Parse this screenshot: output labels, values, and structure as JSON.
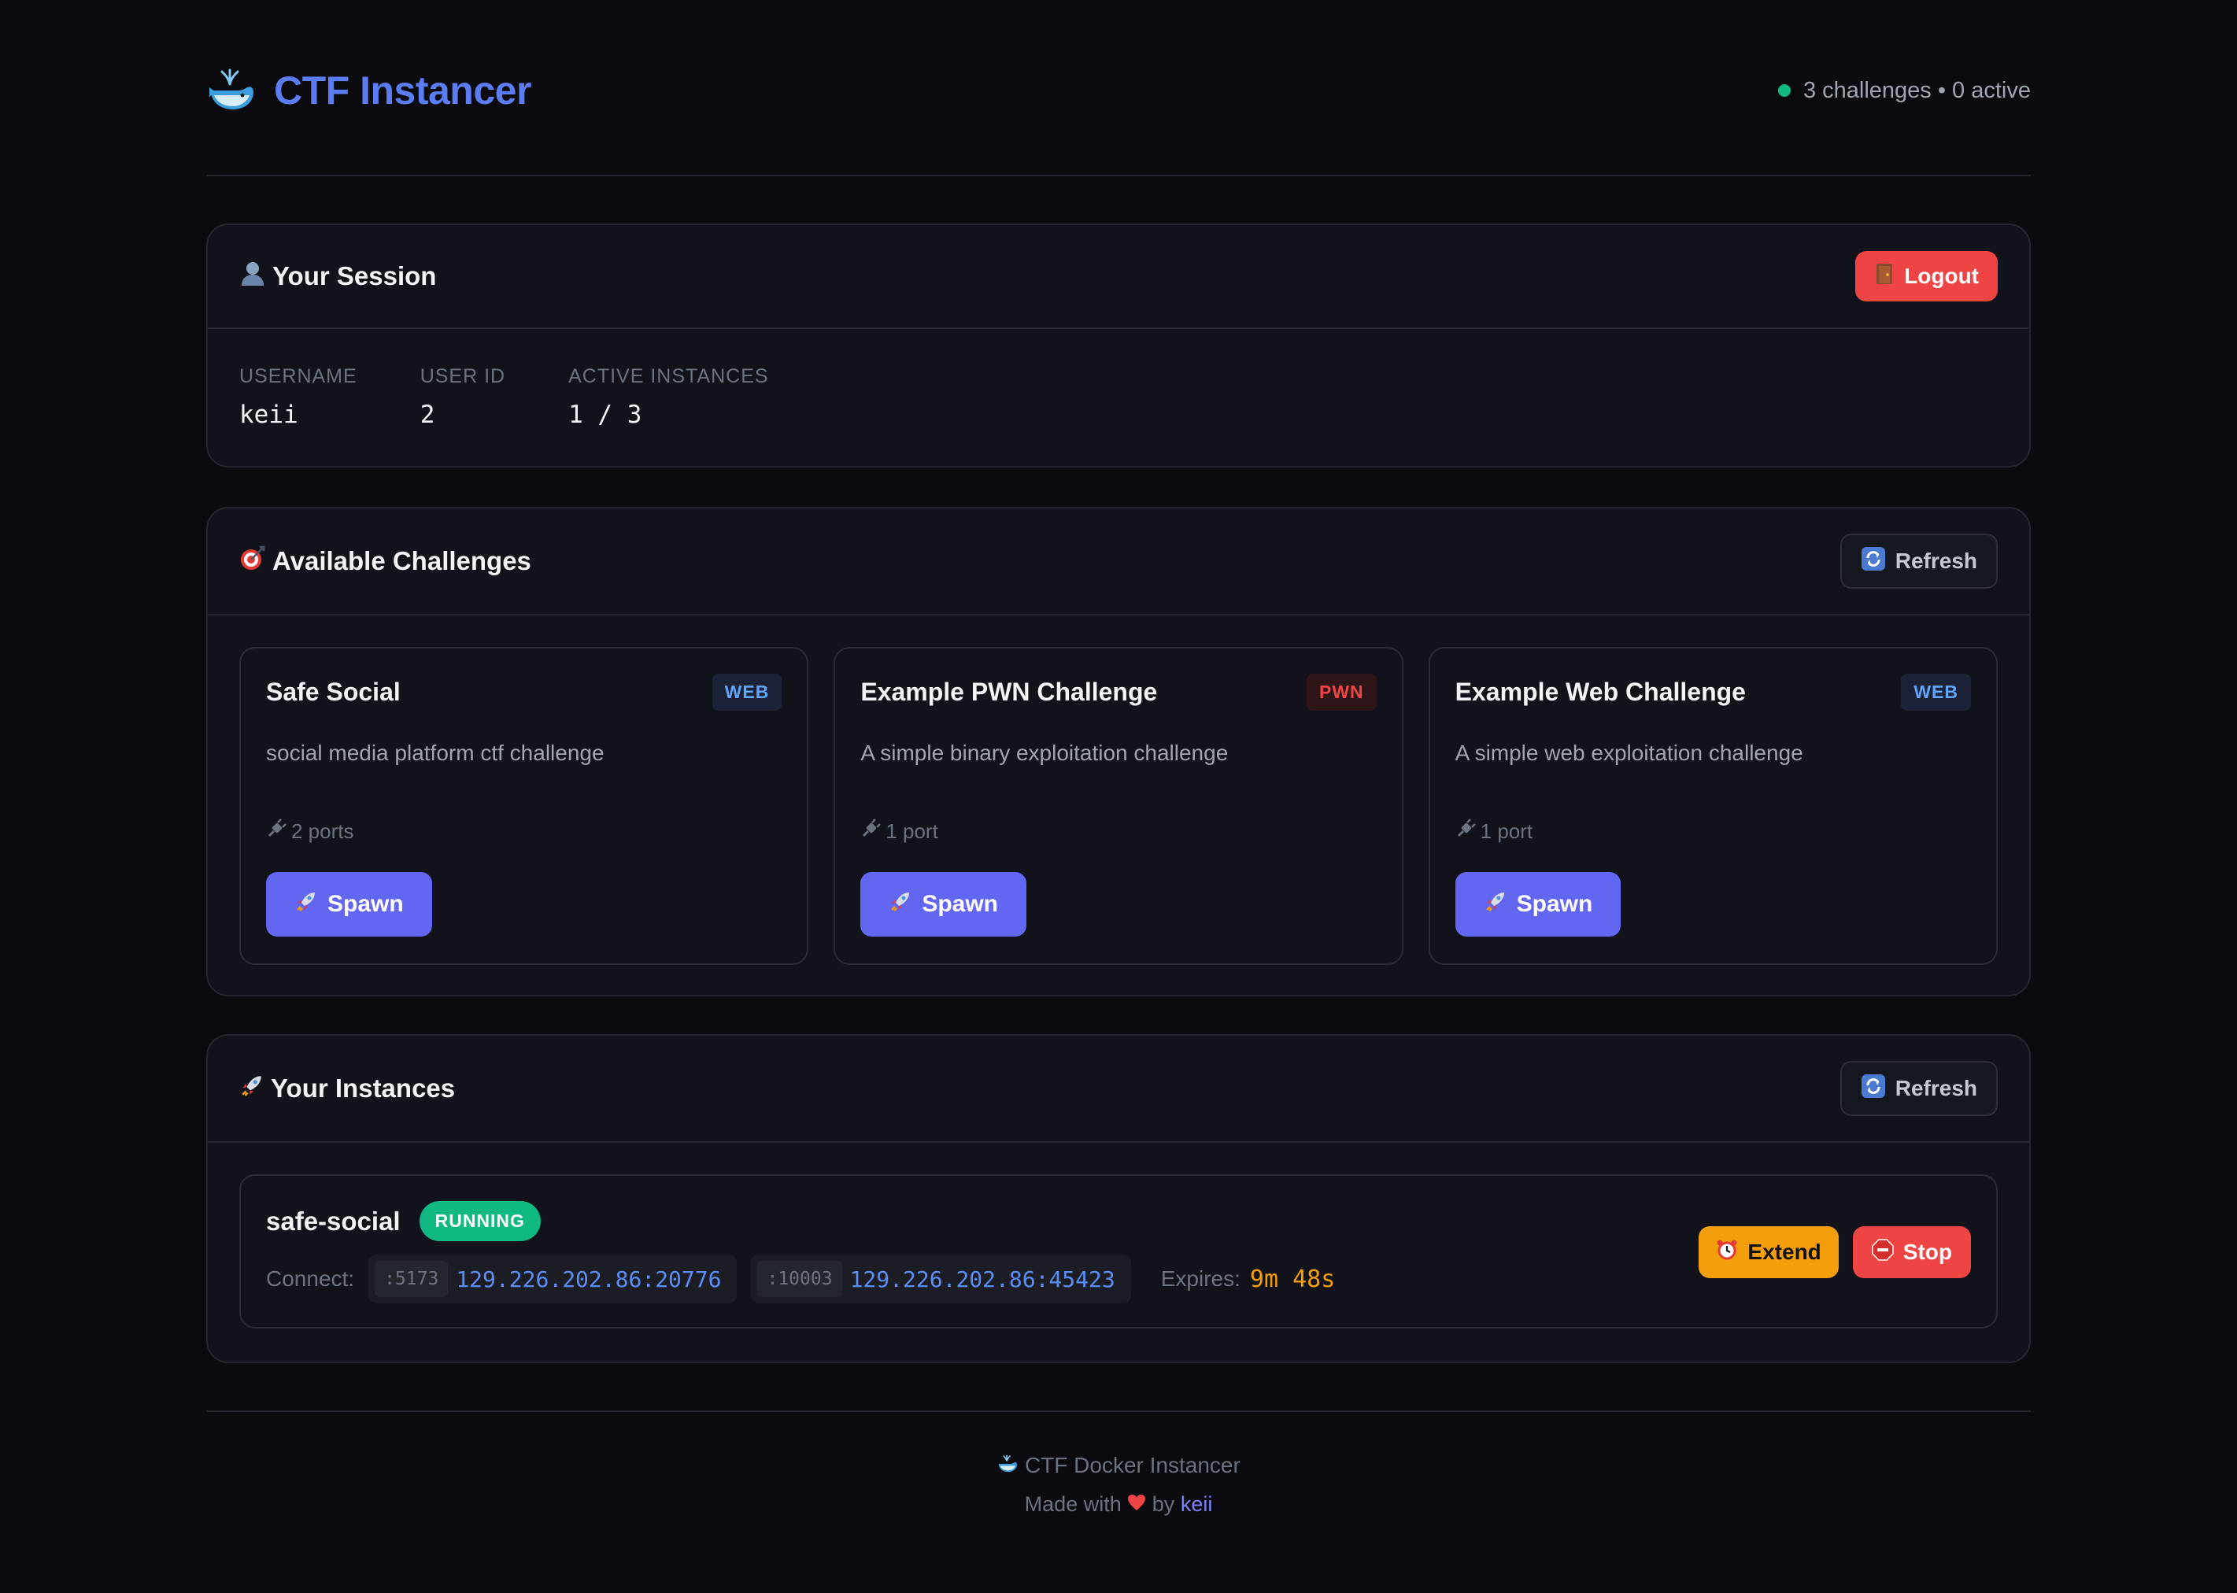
{
  "header": {
    "logo_icon": "whale-icon",
    "title": "CTF Instancer",
    "status_text": "3 challenges • 0 active",
    "status_color": "#10b981"
  },
  "session": {
    "title": "Your Session",
    "icon": "user-icon",
    "logout_label": "Logout",
    "fields": [
      {
        "label": "USERNAME",
        "value": "keii"
      },
      {
        "label": "USER ID",
        "value": "2"
      },
      {
        "label": "ACTIVE INSTANCES",
        "value": "1 / 3"
      }
    ]
  },
  "challenges": {
    "title": "Available Challenges",
    "icon": "target-icon",
    "refresh_label": "Refresh",
    "items": [
      {
        "name": "Safe Social",
        "tag": "WEB",
        "description": "social media platform ctf challenge",
        "ports": "2 ports",
        "spawn_label": "Spawn"
      },
      {
        "name": "Example PWN Challenge",
        "tag": "PWN",
        "description": "A simple binary exploitation challenge",
        "ports": "1 port",
        "spawn_label": "Spawn"
      },
      {
        "name": "Example Web Challenge",
        "tag": "WEB",
        "description": "A simple web exploitation challenge",
        "ports": "1 port",
        "spawn_label": "Spawn"
      }
    ]
  },
  "instances": {
    "title": "Your Instances",
    "icon": "rocket-icon",
    "refresh_label": "Refresh",
    "items": [
      {
        "name": "safe-social",
        "status": "RUNNING",
        "connect_label": "Connect:",
        "connections": [
          {
            "port": ":5173",
            "address": "129.226.202.86:20776"
          },
          {
            "port": ":10003",
            "address": "129.226.202.86:45423"
          }
        ],
        "expires_label": "Expires:",
        "expires_value": "9m 48s",
        "extend_label": "Extend",
        "stop_label": "Stop"
      }
    ]
  },
  "footer": {
    "line1": "CTF Docker Instancer",
    "made_with": "Made with",
    "by": "by",
    "author": "keii"
  },
  "colors": {
    "accent": "#6366f1",
    "brand": "#5b7cf2",
    "danger": "#ef4444",
    "warning": "#f59e0b",
    "success": "#10b981"
  }
}
